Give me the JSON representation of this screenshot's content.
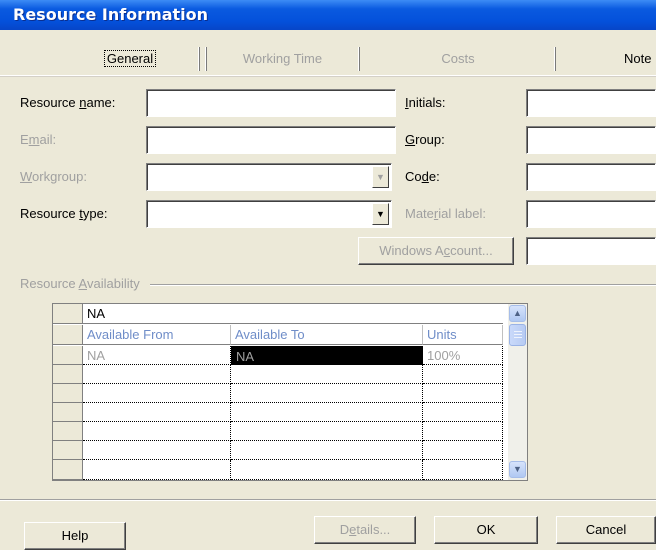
{
  "window": {
    "title": "Resource Information"
  },
  "tabs": [
    {
      "label": "General",
      "active": true
    },
    {
      "label": "Working Time",
      "active": false
    },
    {
      "label": "Costs",
      "active": false
    },
    {
      "label": "Note",
      "active": false
    }
  ],
  "form": {
    "resource_name": {
      "label_pre": "Resource ",
      "label_ul": "n",
      "label_post": "ame:",
      "value": ""
    },
    "email": {
      "label_pre": "E",
      "label_ul": "m",
      "label_post": "ail:",
      "value": ""
    },
    "workgroup": {
      "label_pre": "",
      "label_ul": "W",
      "label_post": "orkgroup:",
      "value": ""
    },
    "resource_type": {
      "label_pre": "Resource ",
      "label_ul": "t",
      "label_post": "ype:",
      "value": ""
    },
    "initials": {
      "label_pre": "",
      "label_ul": "I",
      "label_post": "nitials:",
      "value": ""
    },
    "group": {
      "label_pre": "",
      "label_ul": "G",
      "label_post": "roup:",
      "value": ""
    },
    "code": {
      "label_pre": "Co",
      "label_ul": "d",
      "label_post": "e:",
      "value": ""
    },
    "material_label": {
      "label_pre": "Mate",
      "label_ul": "r",
      "label_post": "ial label:",
      "value": ""
    },
    "windows_account_button": {
      "label_pre": "Windows A",
      "label_ul": "c",
      "label_post": "count..."
    },
    "windows_account_value": ""
  },
  "availability": {
    "group_label_pre": "Resource ",
    "group_label_ul": "A",
    "group_label_post": "vailability",
    "entry_value": "NA",
    "columns": [
      "Available From",
      "Available To",
      "Units"
    ],
    "rows": [
      [
        "NA",
        "NA",
        "100%"
      ],
      [
        "",
        "",
        ""
      ],
      [
        "",
        "",
        ""
      ],
      [
        "",
        "",
        ""
      ],
      [
        "",
        "",
        ""
      ],
      [
        "",
        "",
        ""
      ],
      [
        "",
        "",
        ""
      ]
    ]
  },
  "footer": {
    "help": "Help",
    "details_pre": "D",
    "details_ul": "e",
    "details_post": "tails...",
    "ok": "OK",
    "cancel": "Cancel"
  }
}
